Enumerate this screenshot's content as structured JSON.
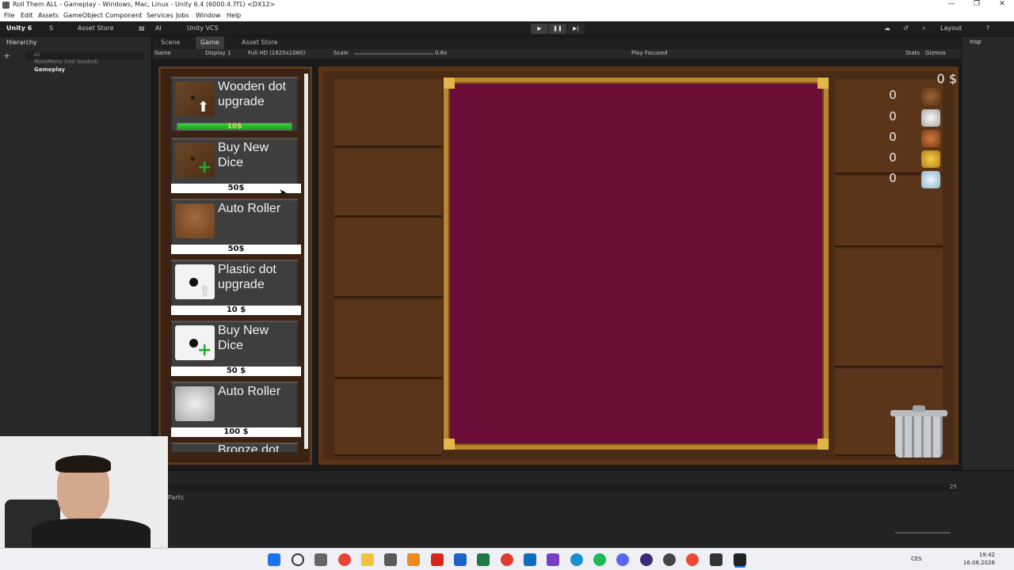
{
  "window": {
    "title": "Roll Them ALL - Gameplay - Windows, Mac, Linux - Unity 6.4 (6000.4.7f1) <DX12>",
    "controls": [
      "—",
      "❐",
      "✕"
    ]
  },
  "menu": [
    "File",
    "Edit",
    "Assets",
    "GameObject",
    "Component",
    "Services",
    "Jobs",
    "Window",
    "Help"
  ],
  "toolbar": {
    "account": "Unity 6",
    "user": "S",
    "asset_store": "Asset Store",
    "ai": "AI",
    "vcs": "Unity VCS",
    "layout": "Layout",
    "play": "▶",
    "pause": "❚❚",
    "step": "▶|"
  },
  "hierarchy": {
    "tab": "Hierarchy",
    "search_placeholder": "All",
    "items": [
      "MainMenu (not loaded)",
      "Gameplay"
    ]
  },
  "game_tabs": [
    "Scene",
    "Game",
    "Asset Store"
  ],
  "game_toolbar": {
    "mode": "Game",
    "display": "Display 1",
    "resolution": "Full HD (1920x1080)",
    "scale_label": "Scale",
    "scale_value": "0.8x",
    "play_focused": "Play Focused",
    "stats": "Stats",
    "gizmos": "Gizmos"
  },
  "inspector_tab": "Insp",
  "shop": {
    "items": [
      {
        "name": "Wooden dot upgrade",
        "price": "10$",
        "progress": 1.0
      },
      {
        "name": "Buy New Dice",
        "price": "50$"
      },
      {
        "name": "Auto Roller",
        "price": "50$"
      },
      {
        "name": "Plastic dot upgrade",
        "price": "10 $"
      },
      {
        "name": "Buy New Dice",
        "price": "50 $"
      },
      {
        "name": "Auto Roller",
        "price": "100 $"
      },
      {
        "name": "Bronze dot"
      }
    ]
  },
  "hud": {
    "money": "0 $",
    "counters": [
      {
        "value": "0",
        "icon": "wooden-bucket-icon"
      },
      {
        "value": "0",
        "icon": "plastic-roller-icon"
      },
      {
        "value": "0",
        "icon": "bronze-roller-icon"
      },
      {
        "value": "0",
        "icon": "gold-roller-icon"
      },
      {
        "value": "0",
        "icon": "diamond-roller-icon"
      }
    ]
  },
  "bottom_panel": {
    "label": "Parts",
    "count": "25"
  },
  "taskbar": {
    "language": "CES",
    "time": "19:42",
    "date": "16.08.2026"
  },
  "colors": {
    "felt": "#6a0e38",
    "felt_border": "#b8862c",
    "wood": "#5a3519",
    "progress_green": "#2fb830"
  }
}
